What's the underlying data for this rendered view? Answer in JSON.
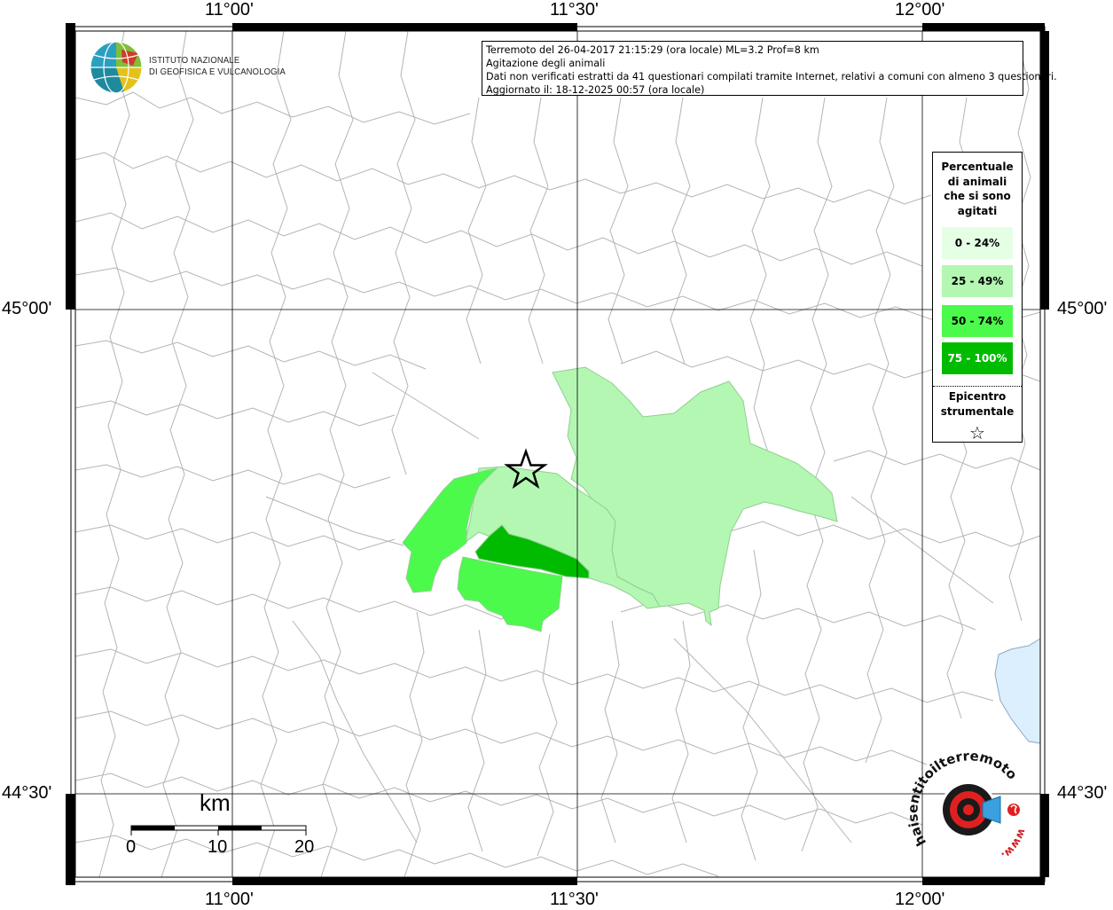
{
  "title": {
    "line1": "Terremoto del 26-04-2017 21:15:29 (ora locale) ML=3.2 Prof=8 km",
    "line2": "Agitazione degli animali",
    "line3": "Dati non verificati estratti da 41 questionari compilati tramite Internet, relativi a comuni con almeno 3 questionari.",
    "line4": "Aggiornato il: 18-12-2025 00:57 (ora locale)"
  },
  "logo": {
    "line1": "ISTITUTO NAZIONALE",
    "line2": "DI GEOFISICA E VULCANOLOGIA"
  },
  "coordinates": {
    "lon_top": [
      "11°00'",
      "11°30'",
      "12°00'"
    ],
    "lon_bottom": [
      "11°00'",
      "11°30'",
      "12°00'"
    ],
    "lat_left": [
      "45°00'",
      "44°30'"
    ],
    "lat_right": [
      "45°00'",
      "44°30'"
    ]
  },
  "legend": {
    "title_lines": [
      "Percentuale",
      "di animali",
      "che si sono",
      "agitati"
    ],
    "classes": [
      {
        "label": "0 - 24%",
        "color": "#e5ffe5",
        "text_color": "#000000"
      },
      {
        "label": "25 - 49%",
        "color": "#b3f7b3",
        "text_color": "#000000"
      },
      {
        "label": "50 - 74%",
        "color": "#4cfa4c",
        "text_color": "#000000"
      },
      {
        "label": "75 - 100%",
        "color": "#00bb00",
        "text_color": "#ffffff"
      }
    ],
    "epicenter_lines": [
      "Epicentro",
      "strumentale"
    ],
    "epicenter_symbol": "☆"
  },
  "scale_bar": {
    "unit": "km",
    "ticks": [
      "0",
      "10",
      "20"
    ]
  },
  "badge": {
    "text": "haisentitoilterremoto.it",
    "url_text": "www."
  },
  "colors": {
    "boundary": "#b4b4b4",
    "grid": "#000000",
    "sea": "#dcefff",
    "frame": "#000000"
  }
}
